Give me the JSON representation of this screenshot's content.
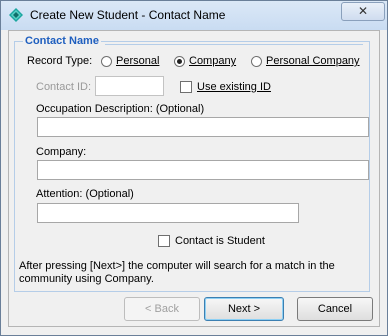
{
  "window": {
    "title": "Create New Student - Contact Name",
    "close_label": "✕"
  },
  "group": {
    "legend": "Contact Name"
  },
  "record_type": {
    "label": "Record Type:",
    "options": [
      {
        "label": "Personal",
        "selected": false
      },
      {
        "label": "Company",
        "selected": true
      },
      {
        "label": "Personal Company",
        "selected": false
      }
    ]
  },
  "contact_id": {
    "label": "Contact ID:",
    "value": "",
    "use_existing_label": "Use existing ID",
    "use_existing_checked": false
  },
  "occupation": {
    "label": "Occupation Description: (Optional)",
    "value": ""
  },
  "company": {
    "label": "Company:",
    "value": ""
  },
  "attention": {
    "label": "Attention:  (Optional)",
    "value": ""
  },
  "contact_is_student": {
    "label": "Contact is Student",
    "checked": false
  },
  "info_text": {
    "line1": "After pressing [Next>] the computer will search for a match in the",
    "line2": "community using Company."
  },
  "buttons": {
    "back": "< Back",
    "next": "Next >",
    "cancel": "Cancel"
  },
  "colors": {
    "legend": "#1f5fbf",
    "titlebar": "#c9dcf2"
  }
}
